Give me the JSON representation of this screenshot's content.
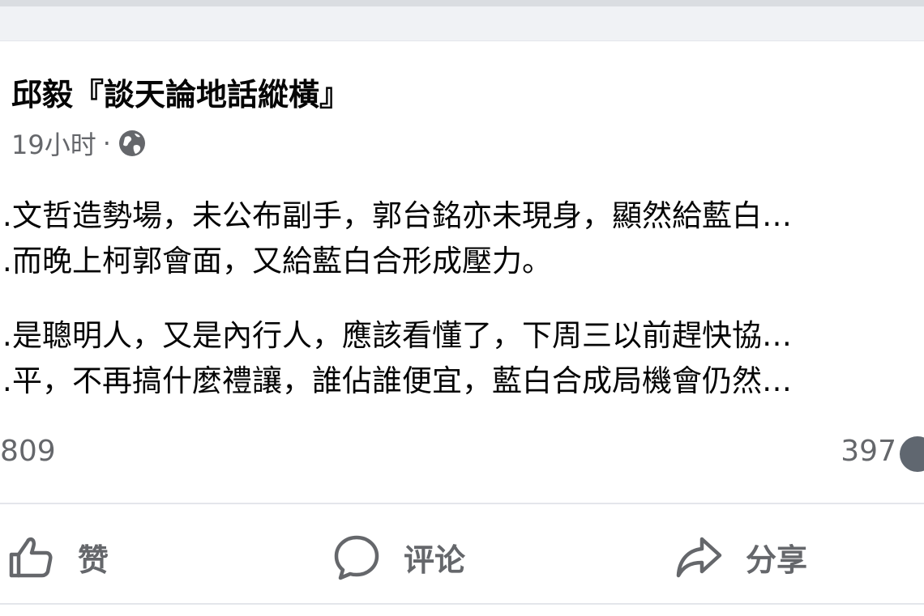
{
  "post": {
    "author": "邱毅『談天論地話縱橫』",
    "timestamp": "19小时",
    "separator": "·",
    "privacy_icon": "globe-icon",
    "paragraphs": [
      [
        "…文哲造勢場，未公布副手，郭台銘亦未現身，顯然給藍白…",
        "…而晚上柯郭會面，又給藍白合形成壓力。"
      ],
      [
        "…是聰明人，又是內行人，應該看懂了，下周三以前趕快協…",
        "…平，不再搞什麼禮讓，誰佔誰便宜，藍白合成局機會仍然…"
      ]
    ]
  },
  "stats": {
    "reactions_count": "809",
    "comments_count": "397"
  },
  "actions": {
    "like_label": "赞",
    "comment_label": "评论",
    "share_label": "分享"
  },
  "colors": {
    "background": "#f0f2f5",
    "card": "#ffffff",
    "text_primary": "#050505",
    "text_secondary": "#65676b",
    "divider": "#e4e6eb"
  }
}
